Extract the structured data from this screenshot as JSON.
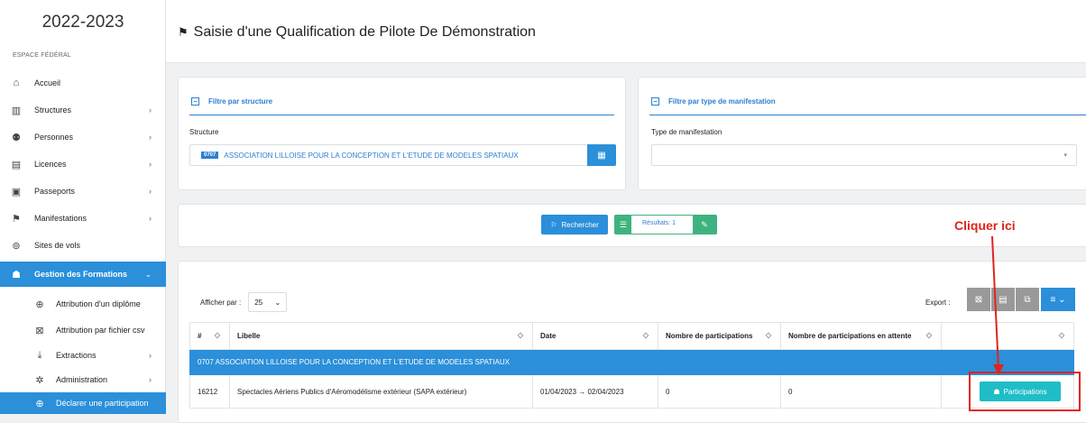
{
  "sidebar": {
    "season": "2022-2023",
    "section": "ESPACE FÉDÉRAL",
    "items": [
      {
        "label": "Accueil",
        "icon": "home-icon",
        "glyph": "⌂"
      },
      {
        "label": "Structures",
        "icon": "building-icon",
        "glyph": "▥",
        "chevron": "›"
      },
      {
        "label": "Personnes",
        "icon": "users-icon",
        "glyph": "⚉",
        "chevron": "›"
      },
      {
        "label": "Licences",
        "icon": "card-icon",
        "glyph": "▤",
        "chevron": "›"
      },
      {
        "label": "Passeports",
        "icon": "passport-icon",
        "glyph": "▣",
        "chevron": "›"
      },
      {
        "label": "Manifestations",
        "icon": "flag-icon",
        "glyph": "⚑",
        "chevron": "›"
      },
      {
        "label": "Sites de vols",
        "icon": "pin-icon",
        "glyph": "⊚"
      },
      {
        "label": "Gestion des Formations",
        "icon": "graduation-cap-icon",
        "glyph": "☗",
        "chevron": "⌄"
      }
    ],
    "subitems": [
      {
        "label": "Attribution d'un diplôme",
        "icon": "plus-circle-icon",
        "glyph": "⊕"
      },
      {
        "label": "Attribution par fichier csv",
        "icon": "excel-file-icon",
        "glyph": "⊠"
      },
      {
        "label": "Extractions",
        "icon": "download-icon",
        "glyph": "⤓",
        "chevron": "›"
      },
      {
        "label": "Administration",
        "icon": "cog-icon",
        "glyph": "✲",
        "chevron": "›"
      },
      {
        "label": "Déclarer une participation",
        "icon": "plus-circle-icon",
        "glyph": "⊕"
      }
    ]
  },
  "header": {
    "title": "Saisie d'une Qualification de Pilote De Démonstration",
    "flag_glyph": "⚑"
  },
  "filters": {
    "structure": {
      "title": "Filtre par structure",
      "label": "Structure",
      "code": "0707",
      "value": "ASSOCIATION LILLOISE POUR LA CONCEPTION ET L'ETUDE DE MODELES SPATIAUX"
    },
    "type": {
      "title": "Filtre par type de manifestation",
      "label": "Type de manifestation",
      "value": ""
    }
  },
  "search": {
    "button": "Rechercher",
    "results": "Résultats: 1"
  },
  "table": {
    "per_page_label": "Afficher par :",
    "per_page": "25",
    "export_label": "Export :",
    "columns": [
      "#",
      "Libelle",
      "Date",
      "Nombre de participations",
      "Nombre de participations en attente",
      ""
    ],
    "group": "0707 ASSOCIATION LILLOISE POUR LA CONCEPTION ET L'ETUDE DE MODELES SPATIAUX",
    "rows": [
      {
        "id": "16212",
        "libelle": "Spectacles Aériens Publics d'Aéromodélisme extérieur (SAPA extérieur)",
        "date": "01/04/2023 → 02/04/2023",
        "participations": "0",
        "attente": "0",
        "action": "Participations"
      }
    ]
  },
  "annotation": {
    "text": "Cliquer ici",
    "color": "#e2231a"
  },
  "colors": {
    "primary": "#2b8fd9",
    "success": "#3fb37f",
    "teal": "#1fbdc7",
    "annotation": "#e2231a"
  }
}
